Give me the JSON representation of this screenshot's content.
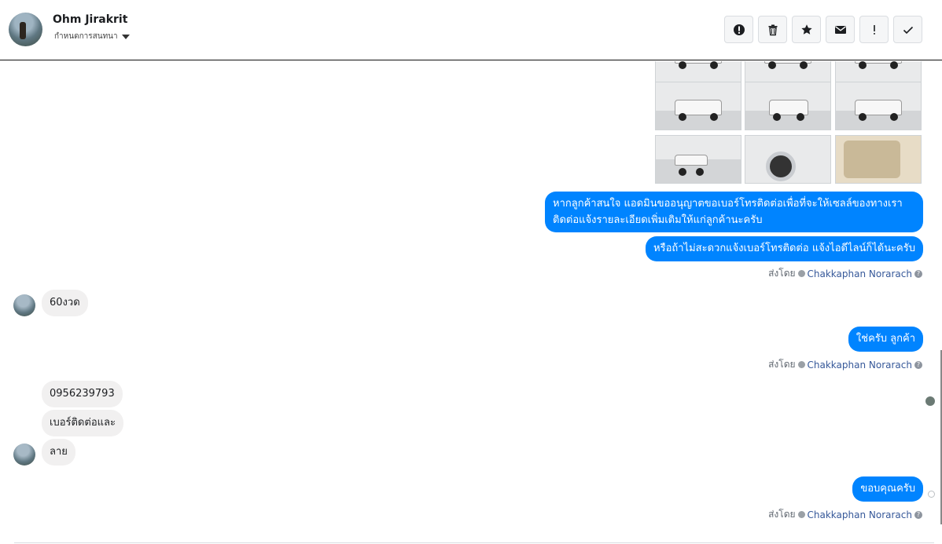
{
  "header": {
    "contact_name": "Ohm Jirakrit",
    "subtitle": "กำหนดการสนทนา",
    "actions": [
      {
        "name": "report-button",
        "icon": "alert-circle-icon"
      },
      {
        "name": "delete-button",
        "icon": "trash-icon"
      },
      {
        "name": "star-button",
        "icon": "star-icon"
      },
      {
        "name": "mark-unread-button",
        "icon": "envelope-icon"
      },
      {
        "name": "mark-important-button",
        "icon": "exclamation-icon"
      },
      {
        "name": "mark-done-button",
        "icon": "check-icon"
      }
    ]
  },
  "thread": {
    "photo_grid": [
      "truck-rear-left",
      "truck-rear",
      "truck-rear-right",
      "truck-rear-left-2",
      "truck-rear-2",
      "truck-rear-right-2",
      "truck-side",
      "truck-wheel-closeup",
      "truck-door-interior"
    ],
    "messages": {
      "out1_line1": "หากลูกค้าสนใจ แอดมินขออนุญาตขอเบอร์โทรติดต่อเพื่อที่จะให้เซลล์ของทางเรา",
      "out1_line2": "ติดต่อแจ้งรายละเอียดเพิ่มเติมให้แก่ลูกค้านะครับ",
      "out2": "หรือถ้าไม่สะดวกแจ้งเบอร์โทรติดต่อ แจ้งไอดีไลน์ก็ได้นะครับ",
      "in1": "60งวด",
      "out3": "ใช่ครับ ลูกค้า",
      "in2": "0956239793",
      "in3": "เบอร์ติดต่อและ",
      "in4": "ลาย",
      "out4": "ขอบคุณครับ"
    },
    "sent_by_label": "ส่งโดย",
    "agent_name": "Chakkaphan Norarach",
    "help_glyph": "?"
  }
}
